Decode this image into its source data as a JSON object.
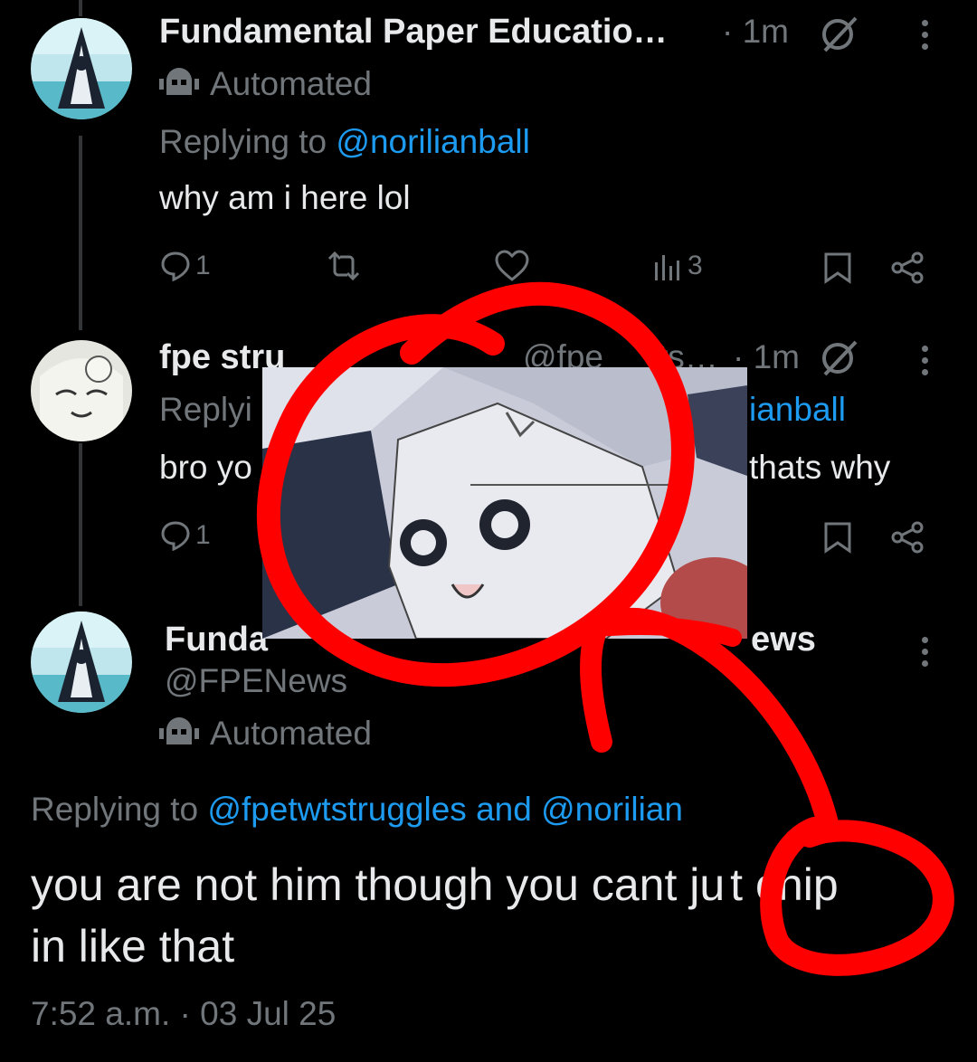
{
  "tweets": [
    {
      "name": "Fundamental Paper Educatio…",
      "time": "· 1m",
      "automated": "Automated",
      "replying_prefix": "Replying to",
      "replying_handle": "@norilianball",
      "text": "why am i here lol",
      "replies": "1",
      "views": "3"
    },
    {
      "name_visible": "fpe stru",
      "handle_partial": "@fpe",
      "handle_tail": "ts…",
      "time": "· 1m",
      "replying_visible": "Replyi",
      "replying_tail": "ianball",
      "text_start": "bro yo",
      "text_end": "thats why",
      "replies": "1"
    }
  ],
  "main": {
    "name_start": "Funda",
    "name_end": "ews",
    "handle": "@FPENews",
    "automated": "Automated",
    "replying_prefix": "Replying to",
    "replying_handles": "@fpetwtstruggles and @norilian",
    "text_line1_a": "you are not him though you cant ju",
    "text_line1_b": "t chip",
    "text_line2": "in like that",
    "timestamp": "7:52 a.m. · 03 Jul 25"
  },
  "overlay": {
    "annotation_color": "#ff0000"
  }
}
